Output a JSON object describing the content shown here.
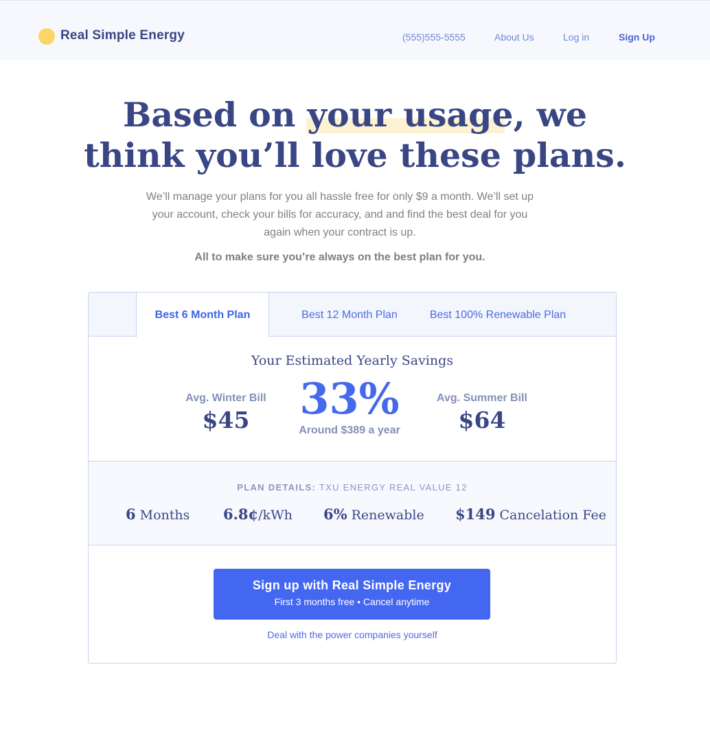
{
  "header": {
    "brand": "Real Simple Energy",
    "nav": {
      "phone": "(555)555-5555",
      "about": "About Us",
      "login": "Log in",
      "signup": "Sign Up"
    }
  },
  "hero": {
    "title_line1": "Based on your usage, we",
    "title_line2": "think you’ll love these plans.",
    "highlight": "your usage,",
    "subtitle": "We’ll manage your plans for you all hassle free for only $9 a month. We’ll set up your account, check your bills for accuracy, and and find the best deal for you again when your contract is up.",
    "note": "All to make sure you’re always on the best plan for you."
  },
  "tabs": [
    {
      "label": "Best 6 Month Plan",
      "active": true
    },
    {
      "label": "Best 12 Month Plan",
      "active": false
    },
    {
      "label": "Best 100% Renewable Plan",
      "active": false
    }
  ],
  "savings": {
    "title": "Your Estimated Yearly Savings",
    "winter_label": "Avg. Winter Bill",
    "winter_value": "$45",
    "percent": "33%",
    "yearly": "Around $389 a year",
    "summer_label": "Avg. Summer Bill",
    "summer_value": "$64"
  },
  "plan_details": {
    "label": "PLAN DETAILS:",
    "plan_name": "TXU ENERGY REAL VALUE 12",
    "items": [
      {
        "value": "6",
        "unit": " Months"
      },
      {
        "value": "6.8¢",
        "unit": "/kWh"
      },
      {
        "value": "6%",
        "unit": " Renewable"
      },
      {
        "value": "$149",
        "unit": " Cancelation Fee"
      }
    ]
  },
  "cta": {
    "main": "Sign up with Real Simple Energy",
    "sub": "First 3 months free • Cancel anytime",
    "alt_link": "Deal with the power companies yourself"
  },
  "colors": {
    "brand_navy": "#3a4684",
    "accent_blue": "#4467f2",
    "logo_yellow": "#fbd666",
    "highlight": "#fdf3d2"
  }
}
